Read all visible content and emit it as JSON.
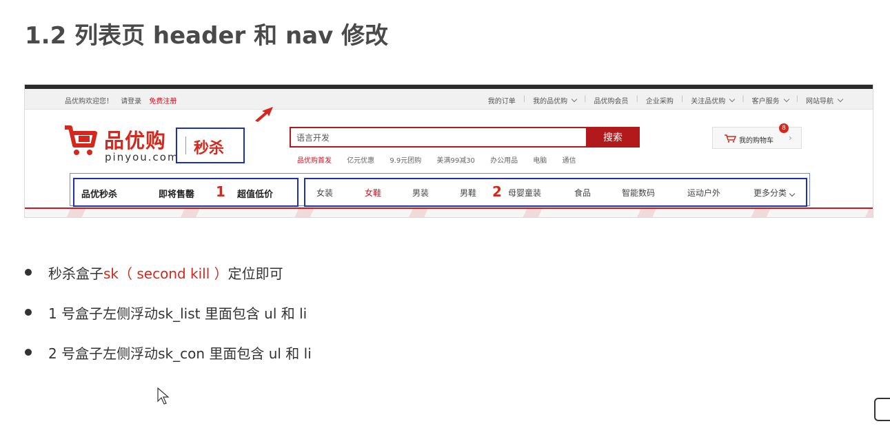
{
  "slide": {
    "title": "1.2 列表页 header 和 nav 修改"
  },
  "shortcut": {
    "welcome": "品优购欢迎您！",
    "login": "请登录",
    "register": "免费注册",
    "links": [
      {
        "label": "我的订单",
        "dropdown": false
      },
      {
        "label": "我的品优购",
        "dropdown": true
      },
      {
        "label": "品优购会员",
        "dropdown": false
      },
      {
        "label": "企业采购",
        "dropdown": false
      },
      {
        "label": "关注品优购",
        "dropdown": true
      },
      {
        "label": "客户服务",
        "dropdown": true
      },
      {
        "label": "网站导航",
        "dropdown": true
      }
    ]
  },
  "logo": {
    "brand": "品优购",
    "pinyin": "pinyou.com",
    "seckill": "秒杀"
  },
  "search": {
    "value": "语言开发",
    "button": "搜索",
    "hotwords": [
      "品优购首发",
      "亿元优惠",
      "9.9元团购",
      "美满99减30",
      "办公用品",
      "电脑",
      "通信"
    ]
  },
  "cart": {
    "label": "我的购物车",
    "count": "8"
  },
  "nav": {
    "sk_list": [
      "品优秒杀",
      "即将售罄",
      "超值低价"
    ],
    "box1_number": "1",
    "sk_con": [
      "女装",
      "女鞋",
      "男装",
      "男鞋",
      "母婴童装",
      "食品",
      "智能数码",
      "运动户外",
      "更多分类"
    ],
    "box2_number": "2",
    "active_category": "女鞋"
  },
  "bullets": [
    {
      "pre": "秒杀盒子 ",
      "hl": "sk（ second  kill ）",
      "post": " 定位即可"
    },
    {
      "pre": "1 号盒子左侧浮动sk_list 里面包含 ul 和 li",
      "hl": "",
      "post": ""
    },
    {
      "pre": "2 号盒子左侧浮动sk_con 里面包含 ul 和 li",
      "hl": "",
      "post": ""
    }
  ],
  "colors": {
    "brand_red": "#d5281c",
    "annotation_blue": "#1c2fb8",
    "search_red": "#b1191a"
  }
}
